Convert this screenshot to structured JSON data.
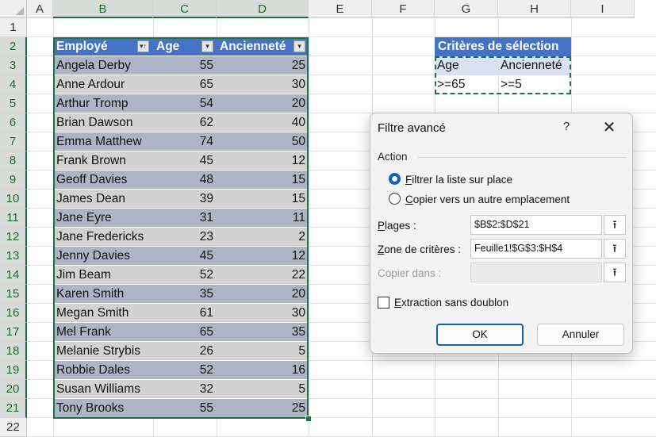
{
  "sheet": {
    "columns": [
      "A",
      "B",
      "C",
      "D",
      "E",
      "F",
      "G",
      "H",
      "I"
    ],
    "rows": [
      "1",
      "2",
      "3",
      "4",
      "5",
      "6",
      "7",
      "8",
      "9",
      "10",
      "11",
      "12",
      "13",
      "14",
      "15",
      "16",
      "17",
      "18",
      "19",
      "20",
      "21",
      "22"
    ]
  },
  "table": {
    "headers": [
      "Employé",
      "Age",
      "Ancienneté"
    ],
    "rows": [
      [
        "Angela Derby",
        "55",
        "25"
      ],
      [
        "Anne Ardour",
        "65",
        "30"
      ],
      [
        "Arthur Tromp",
        "54",
        "20"
      ],
      [
        "Brian Dawson",
        "62",
        "40"
      ],
      [
        "Emma Matthew",
        "74",
        "50"
      ],
      [
        "Frank Brown",
        "45",
        "12"
      ],
      [
        "Geoff Davies",
        "48",
        "15"
      ],
      [
        "James Dean",
        "39",
        "15"
      ],
      [
        "Jane Eyre",
        "31",
        "11"
      ],
      [
        "Jane Fredericks",
        "23",
        "2"
      ],
      [
        "Jenny Davies",
        "45",
        "12"
      ],
      [
        "Jim Beam",
        "52",
        "22"
      ],
      [
        "Karen Smith",
        "35",
        "20"
      ],
      [
        "Megan Smith",
        "61",
        "30"
      ],
      [
        "Mel Frank",
        "65",
        "35"
      ],
      [
        "Melanie Strybis",
        "26",
        "5"
      ],
      [
        "Robbie Dales",
        "52",
        "16"
      ],
      [
        "Susan Williams",
        "32",
        "5"
      ],
      [
        "Tony Brooks",
        "55",
        "25"
      ]
    ]
  },
  "criteria": {
    "title": "Critères de sélection",
    "headers": [
      "Age",
      "Ancienneté"
    ],
    "values": [
      ">=65",
      ">=5"
    ]
  },
  "dialog": {
    "title": "Filtre avancé",
    "help": "?",
    "close": "✕",
    "group_label": "Action",
    "option_in_place_first": "F",
    "option_in_place_rest": "iltrer la liste sur place",
    "option_copy_first": "C",
    "option_copy_rest": "opier vers un autre emplacement",
    "range_label_first": "P",
    "range_label_rest": "lages :",
    "range_value": "$B$2:$D$21",
    "criteria_label_first": "Z",
    "criteria_label_rest": "one de critères :",
    "criteria_value": "Feuille1!$G$3:$H$4",
    "copy_to_label": "Copier dans :",
    "copy_to_value": "",
    "unique_label_first": "E",
    "unique_label_rest": "xtraction sans doublon",
    "ok_label": "OK",
    "cancel_label": "Annuler"
  }
}
